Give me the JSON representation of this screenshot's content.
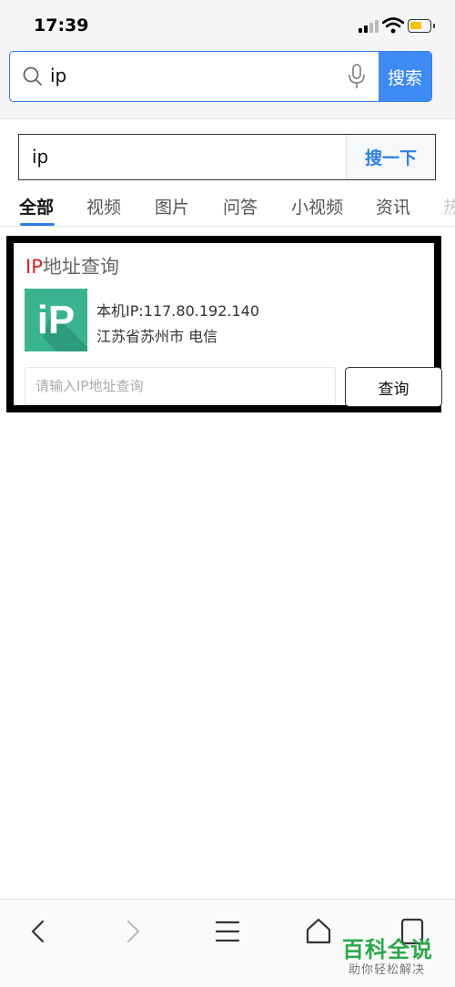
{
  "status_bar": {
    "time": "17:39"
  },
  "browser_bar": {
    "query": "ip",
    "search_button": "搜索"
  },
  "page_search": {
    "query": "ip",
    "button": "搜一下"
  },
  "tabs": [
    {
      "label": "全部",
      "active": true
    },
    {
      "label": "视频"
    },
    {
      "label": "图片"
    },
    {
      "label": "问答"
    },
    {
      "label": "小视频"
    },
    {
      "label": "资讯"
    },
    {
      "label": "热"
    }
  ],
  "ip_card": {
    "title_prefix": "IP",
    "title_rest": "地址查询",
    "logo_text": "iP",
    "ip_line": "本机IP:117.80.192.140",
    "location_line": "江苏省苏州市 电信",
    "input_placeholder": "请输入IP地址查询",
    "query_button": "查询"
  },
  "watermark": {
    "title": "百科全说",
    "subtitle": "助你轻松解决"
  },
  "colors": {
    "accent": "#3d8af2",
    "logo_bg": "#3ab490",
    "title_red": "#e02020",
    "watermark_green": "#2aa84a"
  }
}
